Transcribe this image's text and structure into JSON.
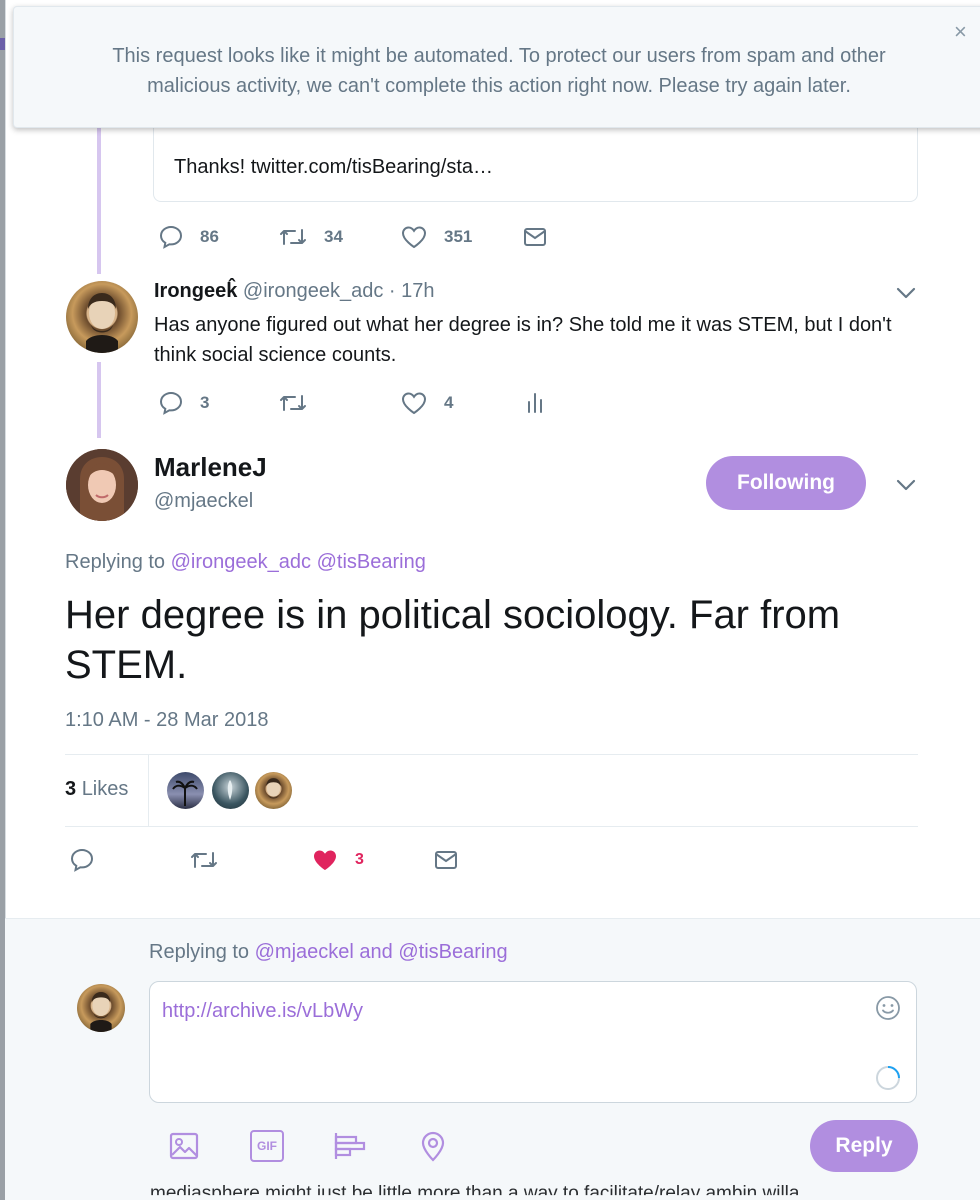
{
  "alert": {
    "message": "This request looks like it might be automated. To protect our users from spam and other malicious activity, we can't complete this action right now. Please try again later.",
    "close_symbol": "×"
  },
  "quoted_tweet": {
    "text": "Thanks! twitter.com/tisBearing/sta…",
    "replies": "86",
    "retweets": "34",
    "likes": "351"
  },
  "reply_tweet": {
    "name": "Irongeek̂",
    "handle": "@irongeek_adc",
    "separator": "·",
    "time": "17h",
    "text": "Has anyone figured out what her degree is in? She told me it was STEM, but I don't think social science counts.",
    "replies": "3",
    "likes": "4"
  },
  "main_tweet": {
    "name": "MarleneJ",
    "handle": "@mjaeckel",
    "follow_label": "Following",
    "replying_prefix": "Replying to",
    "replying_to": [
      "@irongeek_adc",
      "@tisBearing"
    ],
    "text": "Her degree is in political sociology. Far from STEM.",
    "timestamp": "1:10 AM - 28 Mar 2018",
    "likes_count": "3",
    "likes_word": "Likes",
    "heart_count": "3"
  },
  "composer": {
    "replying_prefix": "Replying to",
    "replying_to_1": "@mjaeckel",
    "joiner": "and",
    "replying_to_2": "@tisBearing",
    "text": "http://archive.is/vLbWy",
    "reply_label": "Reply",
    "gif_label": "GIF"
  },
  "below_text": "mediasphere might just be little more than a way to facilitate/relay ambin willa",
  "colors": {
    "accent": "#b18ee0",
    "link": "#9b6ed9",
    "like_red": "#e0245e",
    "muted": "#657786"
  },
  "icons": [
    "close-icon",
    "reply-icon",
    "retweet-icon",
    "like-icon",
    "message-icon",
    "analytics-icon",
    "chevron-down-icon",
    "emoji-icon",
    "image-icon",
    "gif-icon",
    "poll-icon",
    "location-icon",
    "spinner-icon"
  ]
}
